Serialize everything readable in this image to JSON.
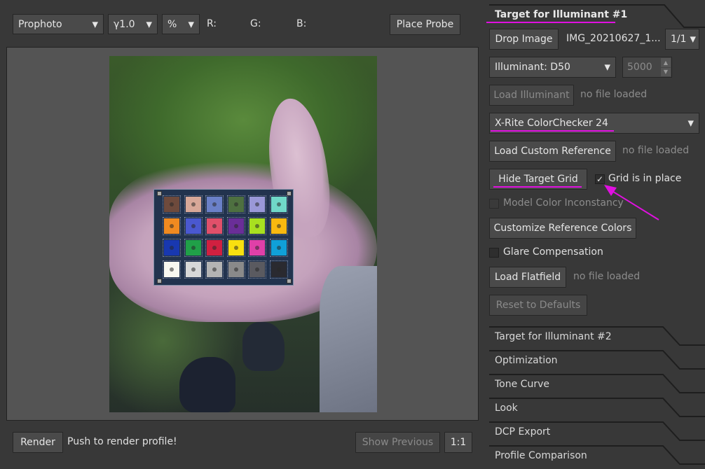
{
  "toolbar": {
    "colorspace": "Prophoto",
    "gamma": "γ1.0",
    "unit": "%",
    "r_label": "R:",
    "g_label": "G:",
    "b_label": "B:",
    "place_probe": "Place Probe"
  },
  "bottom_bar": {
    "render": "Render",
    "hint": "Push to render profile!",
    "show_previous": "Show Previous",
    "zoom": "1:1"
  },
  "panel": {
    "active_section": "Target for Illuminant #1",
    "drop_image": "Drop Image",
    "image_name": "IMG_20210627_1...",
    "image_index": "1/1",
    "illuminant": "Illuminant: D50",
    "temperature": "5000",
    "load_illuminant": "Load Illuminant",
    "no_file_1": "no file loaded",
    "reference_target": "X-Rite ColorChecker 24",
    "load_custom_reference": "Load Custom Reference",
    "no_file_2": "no file loaded",
    "hide_target_grid": "Hide Target Grid",
    "grid_in_place": "Grid is in place",
    "model_color_inconstancy": "Model Color Inconstancy",
    "customize_reference_colors": "Customize Reference Colors",
    "glare_compensation": "Glare Compensation",
    "load_flatfield": "Load Flatfield",
    "no_file_3": "no file loaded",
    "reset_to_defaults": "Reset to Defaults",
    "sections": [
      "Target for Illuminant #2",
      "Optimization",
      "Tone Curve",
      "Look",
      "DCP Export",
      "Profile Comparison"
    ]
  },
  "colors": {
    "background": "#383838",
    "highlight": "#e010e0",
    "checker": [
      [
        "#6e4a3c",
        "#d8a898",
        "#6a80c8",
        "#4e7040",
        "#9a98d8",
        "#70d8c8"
      ],
      [
        "#f08a20",
        "#4a58d0",
        "#e0506a",
        "#6a2e98",
        "#a8e020",
        "#f8b810"
      ],
      [
        "#1838b0",
        "#20a048",
        "#d02040",
        "#f8e010",
        "#e040a8",
        "#10a0d8"
      ],
      [
        "#f8f8f0",
        "#d8d8d8",
        "#b4b4b4",
        "#8a8a8a",
        "#5a5a60",
        "#2a2a30"
      ]
    ]
  }
}
